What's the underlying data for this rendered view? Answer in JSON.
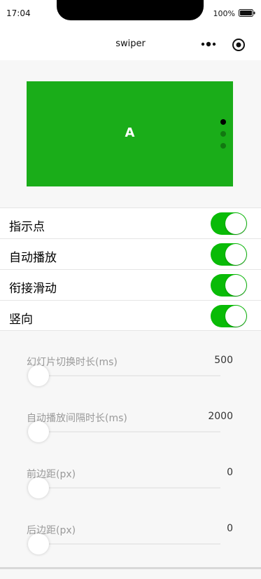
{
  "status": {
    "time": "17:04",
    "battery": "100%"
  },
  "nav": {
    "title": "swiper"
  },
  "swiper": {
    "slide_label": "A",
    "active_index": 0,
    "dot_count": 3,
    "slide_color": "#1aad19"
  },
  "toggles": [
    {
      "label": "指示点",
      "on": true
    },
    {
      "label": "自动播放",
      "on": true
    },
    {
      "label": "衔接滑动",
      "on": true
    },
    {
      "label": "竖向",
      "on": true
    }
  ],
  "sliders": [
    {
      "label": "幻灯片切换时长(ms)",
      "value": "500"
    },
    {
      "label": "自动播放间隔时长(ms)",
      "value": "2000"
    },
    {
      "label": "前边距(px)",
      "value": "0"
    },
    {
      "label": "后边距(px)",
      "value": "0"
    }
  ],
  "colors": {
    "switch_on": "#09bb07",
    "background": "#f7f7f7"
  }
}
